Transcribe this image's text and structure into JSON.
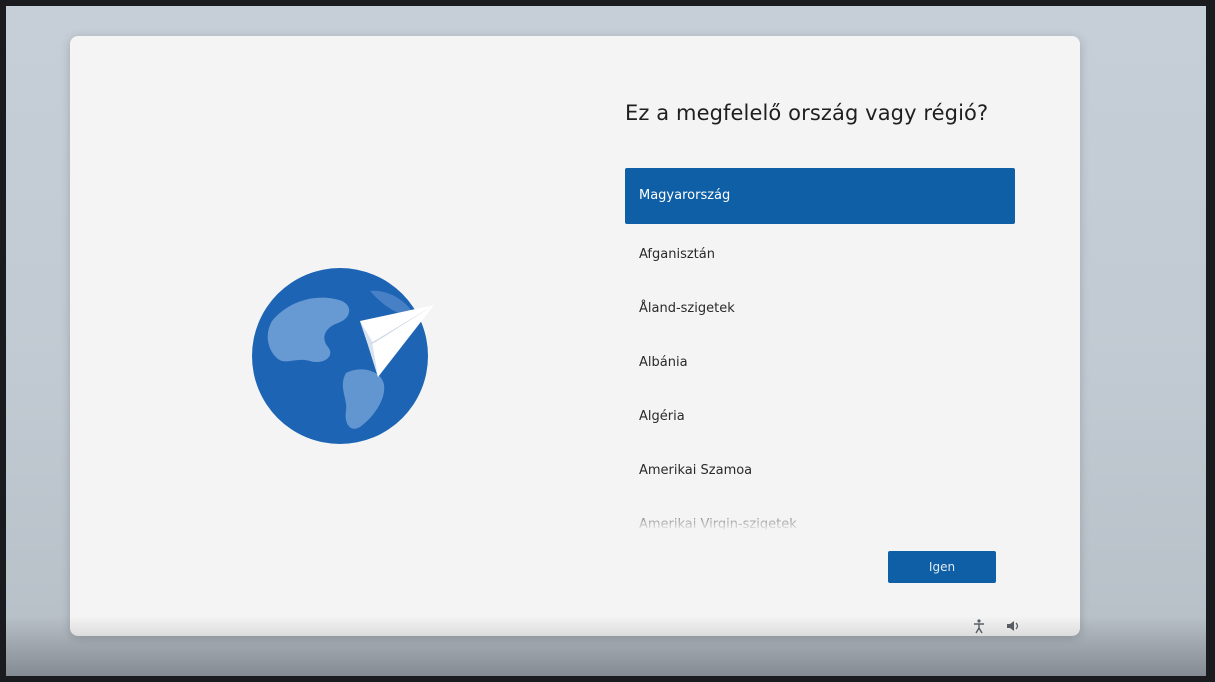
{
  "setup": {
    "title": "Ez a megfelelő ország vagy régió?",
    "regions": [
      "Magyarország",
      "Afganisztán",
      "Åland-szigetek",
      "Albánia",
      "Algéria",
      "Amerikai Szamoa",
      "Amerikai Virgin-szigetek"
    ],
    "selected_index": 0,
    "next_button_label": "Igen"
  },
  "system_tray": {
    "icons": [
      "accessibility-icon",
      "volume-icon"
    ]
  },
  "colors": {
    "accent": "#0f5fa6",
    "card_background": "#f4f4f4",
    "globe_dark": "#1e64b4",
    "globe_light": "#6f9fd6"
  }
}
